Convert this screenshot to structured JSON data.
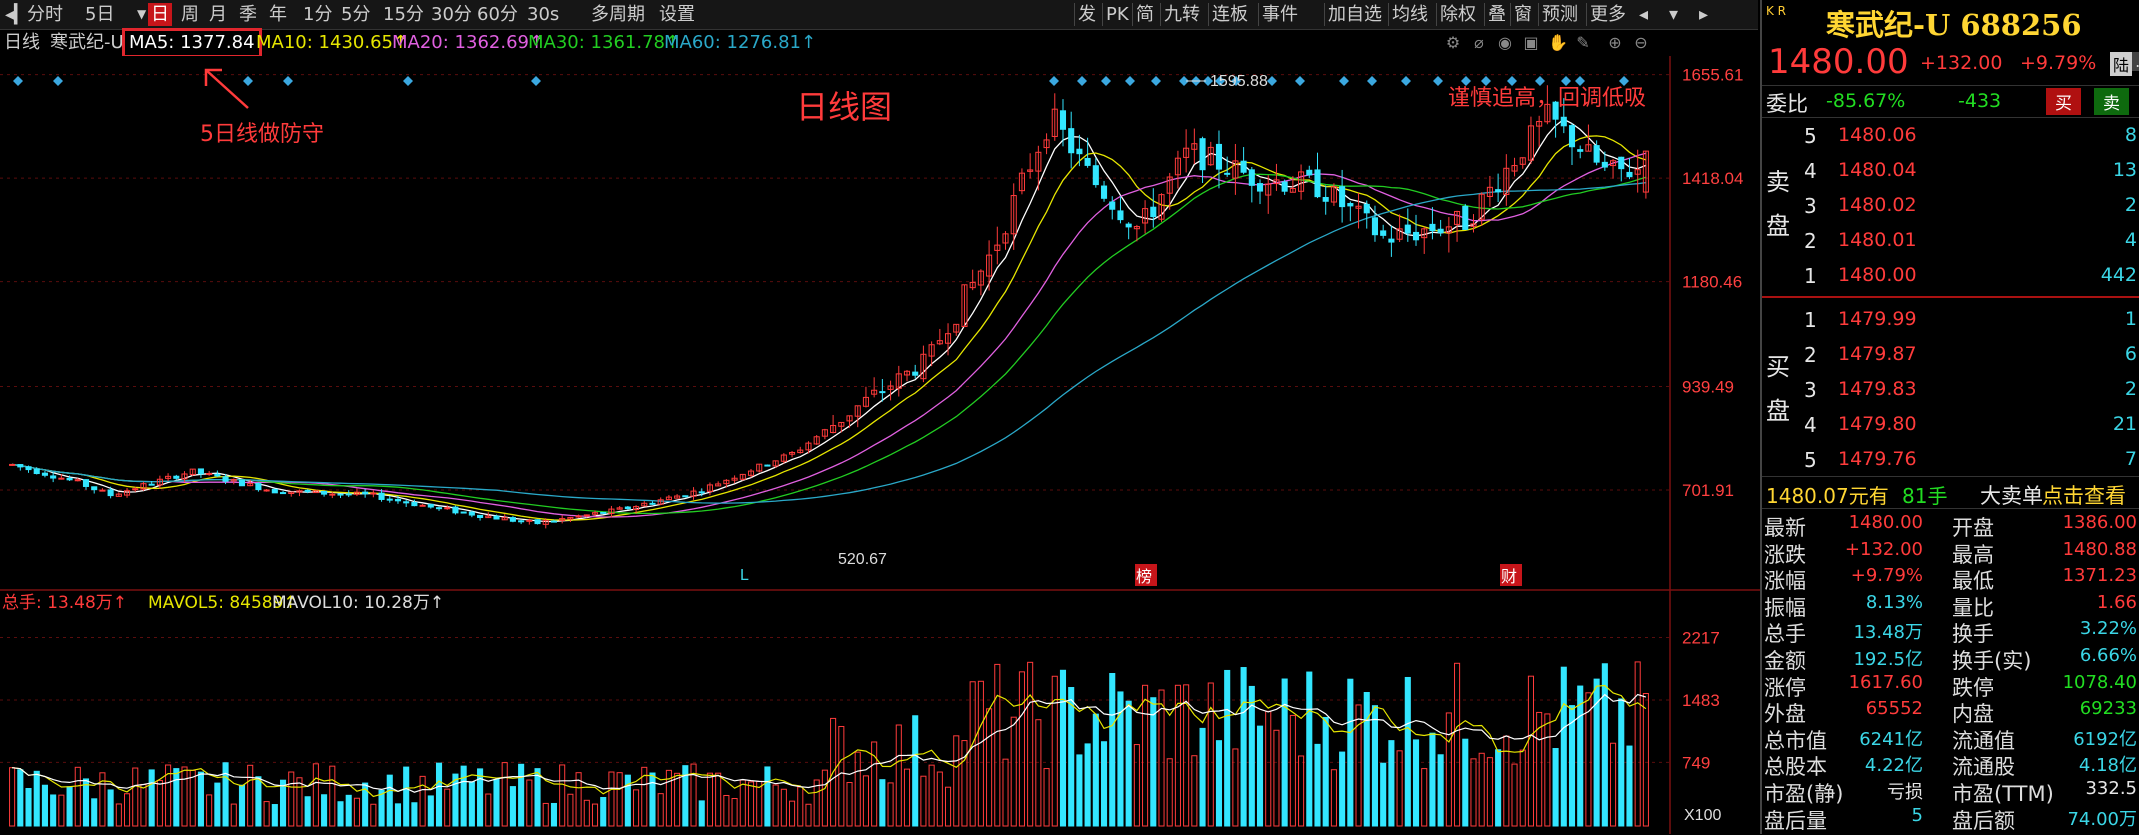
{
  "toolbar": {
    "left_items": [
      "分时",
      "5日",
      "日",
      "周",
      "月",
      "季",
      "年",
      "1分",
      "5分",
      "15分",
      "30分",
      "60分",
      "30s",
      "多周期",
      "设置"
    ],
    "active": "日",
    "right_items": [
      "发",
      "PK",
      "简",
      "九转",
      "连板",
      "事件",
      "加自选",
      "均线",
      "除权",
      "叠",
      "窗",
      "预测",
      "更多"
    ]
  },
  "ma_line": {
    "period": "日线",
    "stock": "寒武纪-U",
    "ma5": "MA5: 1377.84",
    "ma10": "MA10: 1430.65↑",
    "ma20": "MA20: 1362.69↑",
    "ma30": "MA30: 1361.78↑",
    "ma60": "MA60: 1276.81↑"
  },
  "colors": {
    "ma5": "#ffffff",
    "ma10": "#e6e600",
    "ma20": "#e060e0",
    "ma30": "#22cc22",
    "ma60": "#2aa8c8",
    "up": "#ff3b3b",
    "down": "#33e6ff",
    "grid": "#5a0d0d"
  },
  "annotations": {
    "chart_title": "日线图",
    "ma5_note": "5日线做防守",
    "strategy_note": "谨慎追高，回调低吸"
  },
  "price_axis": [
    "1655.61",
    "1418.04",
    "1180.46",
    "939.49",
    "701.91"
  ],
  "volume_axis": [
    "2217",
    "1483",
    "749",
    "X100"
  ],
  "chart_markers": {
    "high_label": "1595.88",
    "low_label": "520.67",
    "L": "L",
    "bang": "榜",
    "cai": "财"
  },
  "volume_line": {
    "total": "总手: 13.48万↑",
    "mavol5": "MAVOL5: 84589↑",
    "mavol10": "MAVOL10: 10.28万↑"
  },
  "quote": {
    "kr": "K R",
    "name": "寒武纪-U 688256",
    "price": "1480.00",
    "change": "+132.00",
    "pct": "+9.79%",
    "tag_lu": "陆",
    "weibi_label": "委比",
    "weibi": "-85.67%",
    "weicha": "-433",
    "buy_btn": "买",
    "sell_btn": "卖"
  },
  "sell_side_label": [
    "卖",
    "盘"
  ],
  "buy_side_label": [
    "买",
    "盘"
  ],
  "asks": [
    {
      "lvl": "5",
      "price": "1480.06",
      "vol": "8"
    },
    {
      "lvl": "4",
      "price": "1480.04",
      "vol": "13"
    },
    {
      "lvl": "3",
      "price": "1480.02",
      "vol": "2"
    },
    {
      "lvl": "2",
      "price": "1480.01",
      "vol": "4"
    },
    {
      "lvl": "1",
      "price": "1480.00",
      "vol": "442"
    }
  ],
  "bids": [
    {
      "lvl": "1",
      "price": "1479.99",
      "vol": "1"
    },
    {
      "lvl": "2",
      "price": "1479.87",
      "vol": "6"
    },
    {
      "lvl": "3",
      "price": "1479.83",
      "vol": "2"
    },
    {
      "lvl": "4",
      "price": "1479.80",
      "vol": "21"
    },
    {
      "lvl": "5",
      "price": "1479.76",
      "vol": "7"
    }
  ],
  "big_order": {
    "price": "1480.07元有",
    "qty": "81手",
    "label": "大卖单",
    "link": "点击查看"
  },
  "stats": [
    {
      "l1": "最新",
      "v1": "1480.00",
      "c1": "red",
      "l2": "开盘",
      "v2": "1386.00",
      "c2": "red"
    },
    {
      "l1": "涨跌",
      "v1": "+132.00",
      "c1": "red",
      "l2": "最高",
      "v2": "1480.88",
      "c2": "red"
    },
    {
      "l1": "涨幅",
      "v1": "+9.79%",
      "c1": "red",
      "l2": "最低",
      "v2": "1371.23",
      "c2": "red"
    },
    {
      "l1": "振幅",
      "v1": "8.13%",
      "c1": "cyan",
      "l2": "量比",
      "v2": "1.66",
      "c2": "red"
    },
    {
      "l1": "总手",
      "v1": "13.48万",
      "c1": "cyan",
      "l2": "换手",
      "v2": "3.22%",
      "c2": "cyan"
    },
    {
      "l1": "金额",
      "v1": "192.5亿",
      "c1": "cyan",
      "l2": "换手(实)",
      "v2": "6.66%",
      "c2": "cyan"
    },
    {
      "l1": "涨停",
      "v1": "1617.60",
      "c1": "red",
      "l2": "跌停",
      "v2": "1078.40",
      "c2": "green"
    },
    {
      "l1": "外盘",
      "v1": "65552",
      "c1": "red",
      "l2": "内盘",
      "v2": "69233",
      "c2": "green"
    },
    {
      "l1": "总市值",
      "v1": "6241亿",
      "c1": "cyan",
      "l2": "流通值",
      "v2": "6192亿",
      "c2": "cyan"
    },
    {
      "l1": "总股本",
      "v1": "4.22亿",
      "c1": "cyan",
      "l2": "流通股",
      "v2": "4.18亿",
      "c2": "cyan"
    },
    {
      "l1": "市盈(静)",
      "v1": "亏损",
      "c1": "white",
      "l2": "市盈(TTM)",
      "v2": "332.5",
      "c2": "white"
    },
    {
      "l1": "盘后量",
      "v1": "5",
      "c1": "cyan",
      "l2": "盘后额",
      "v2": "74.00万",
      "c2": "cyan"
    }
  ],
  "chart_data": {
    "type": "candlestick",
    "title": "",
    "ylim_price": [
      520.67,
      1655.61
    ],
    "ylim_volume": [
      0,
      2217
    ],
    "volume_unit": "X100",
    "highest": 1595.88,
    "lowest": 520.67,
    "last_close": 1480.0
  }
}
